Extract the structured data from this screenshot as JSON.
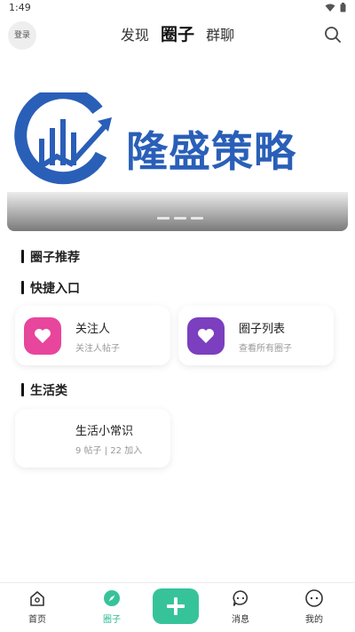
{
  "status_bar": {
    "time": "1:49"
  },
  "top_nav": {
    "login": "登录",
    "tabs": [
      "发现",
      "圈子",
      "群聊"
    ],
    "active_tab": "圈子"
  },
  "banner": {
    "logo_text": "隆盛策略"
  },
  "sections": {
    "recommend": "圈子推荐",
    "shortcuts": "快捷入口",
    "life": "生活类"
  },
  "shortcuts": [
    {
      "title": "关注人",
      "subtitle": "关注人帖子",
      "color": "#e8459c"
    },
    {
      "title": "圈子列表",
      "subtitle": "查看所有圈子",
      "color": "#7b3fbf"
    }
  ],
  "life_card": {
    "title": "生活小常识",
    "meta": "9 帖子 | 22 加入"
  },
  "bottom_nav": {
    "home": "首页",
    "circle": "圈子",
    "messages": "消息",
    "mine": "我的",
    "accent": "#37c39a"
  }
}
